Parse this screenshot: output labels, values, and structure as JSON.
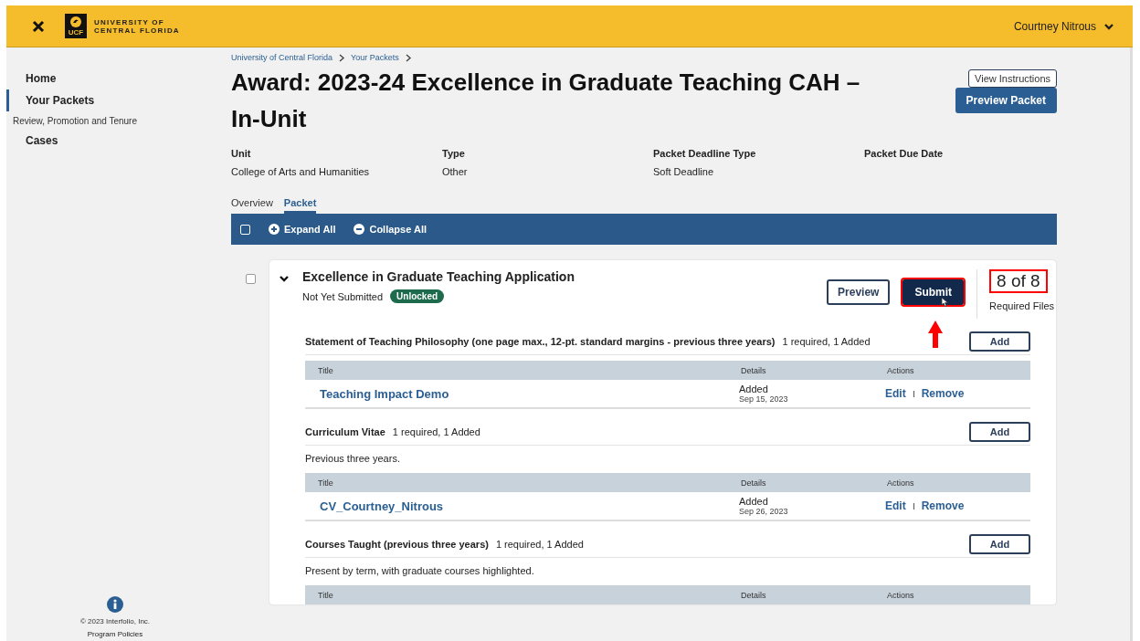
{
  "header": {
    "logo_lines": [
      "UNIVERSITY OF",
      "CENTRAL FLORIDA"
    ],
    "logo_badge": "UCF",
    "user": "Courtney Nitrous"
  },
  "sidebar": {
    "items": [
      {
        "kind": "link",
        "label": "Home",
        "selected": false
      },
      {
        "kind": "link",
        "label": "Your Packets",
        "selected": true
      },
      {
        "kind": "group",
        "label": "Review, Promotion and Tenure",
        "selected": false
      },
      {
        "kind": "link",
        "label": "Cases",
        "selected": false
      }
    ],
    "copyright": "© 2023 Interfolio, Inc.",
    "footer_link": "Program Policies"
  },
  "breadcrumb": [
    "University of Central Florida",
    "Your Packets"
  ],
  "title": "Award: 2023-24 Excellence in Graduate Teaching CAH – In-Unit",
  "buttons": [
    {
      "kind": "outline",
      "label": "View Instructions"
    },
    {
      "kind": "primary",
      "label": "Preview Packet"
    }
  ],
  "meta": [
    {
      "label": "Unit",
      "value": "College of Arts and Humanities"
    },
    {
      "label": "Type",
      "value": "Other"
    },
    {
      "label": "Packet Deadline Type",
      "value": "Soft Deadline"
    },
    {
      "label": "Packet Due Date"
    }
  ],
  "tabs": [
    {
      "label": "Overview",
      "selected": false
    },
    {
      "label": "Packet",
      "selected": true
    }
  ],
  "toolbar": {
    "checked": false,
    "actions": [
      {
        "kind": "expand",
        "label": "Expand All"
      },
      {
        "kind": "collapse",
        "label": "Collapse All"
      }
    ]
  },
  "packet": {
    "checked": false,
    "expanded": true,
    "title": "Excellence in Graduate Teaching Application",
    "status": "Not Yet Submitted",
    "badge": "Unlocked",
    "preview": "Preview",
    "submit": {
      "label": "Submit",
      "highlighted": true,
      "pointer_arrow": true
    },
    "count": {
      "value": "8 of 8",
      "label": "Required Files",
      "highlighted": true
    },
    "sections": [
      {
        "title": "Statement of Teaching Philosophy (one page max., 12-pt. standard margins - previous three years)",
        "requirement": "1 required, 1 Added",
        "add": "Add",
        "columns": [
          "Title",
          "Details",
          "Actions"
        ],
        "rows": [
          {
            "title": "Teaching Impact Demo",
            "status": "Added",
            "date": "Sep 15, 2023",
            "actions": [
              "Edit",
              "Remove"
            ]
          }
        ]
      },
      {
        "title": "Curriculum Vitae",
        "requirement": "1 required, 1 Added",
        "add": "Add",
        "description": "Previous three years.",
        "columns": [
          "Title",
          "Details",
          "Actions"
        ],
        "rows": [
          {
            "title": "CV_Courtney_Nitrous",
            "status": "Added",
            "date": "Sep 26, 2023",
            "actions": [
              "Edit",
              "Remove"
            ]
          }
        ]
      },
      {
        "title": "Courses Taught (previous three years)",
        "requirement": "1 required, 1 Added",
        "add": "Add",
        "description": "Present by term, with graduate courses highlighted.",
        "columns": [
          "Title",
          "Details",
          "Actions"
        ]
      }
    ]
  }
}
